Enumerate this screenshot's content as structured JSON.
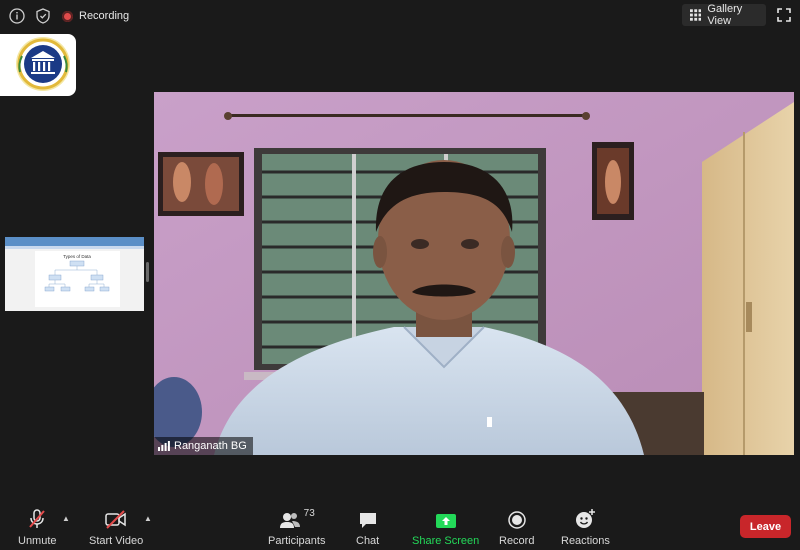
{
  "topbar": {
    "recording_label": "Recording",
    "gallery_label": "Gallery View"
  },
  "shared_thumbnail": {
    "slide_title": "Types of Data"
  },
  "video": {
    "participant_name": "Ranganath BG"
  },
  "toolbar": {
    "unmute_label": "Unmute",
    "start_video_label": "Start Video",
    "participants_label": "Participants",
    "participants_count": "73",
    "chat_label": "Chat",
    "share_screen_label": "Share Screen",
    "record_label": "Record",
    "reactions_label": "Reactions",
    "leave_label": "Leave"
  },
  "colors": {
    "share_green": "#23d959",
    "leave_red": "#c8262a",
    "recording_red": "#e04b4b"
  }
}
